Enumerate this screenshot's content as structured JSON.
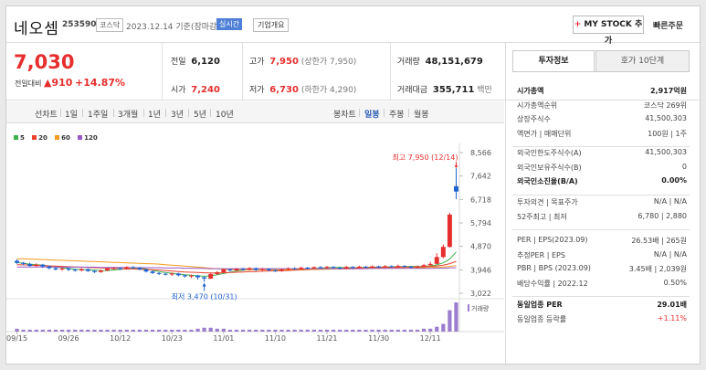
{
  "header": {
    "company": "네오셈",
    "code": "253590",
    "market": "코스닥",
    "date_note": "2023.12.14 기준(장마감)",
    "realtime_label": "실시간",
    "corp_info_label": "기업개요",
    "my_stock_label": "MY STOCK 추가",
    "quick_order_label": "빠른주문"
  },
  "price": {
    "current": "7,030",
    "change_label": "전일대비",
    "change_arrow": "▲",
    "change_amount": "910",
    "change_pct": "+14.87%"
  },
  "quote": {
    "prev_close_label": "전일",
    "prev_close": "6,120",
    "open_label": "시가",
    "open": "7,240",
    "high_label": "고가",
    "high": "7,950",
    "upper_limit": "(상한가 7,950)",
    "low_label": "저가",
    "low": "6,730",
    "lower_limit": "(하한가 4,290)",
    "volume_label": "거래량",
    "volume": "48,151,679",
    "value_label": "거래대금",
    "value": "355,711",
    "value_unit": "백만"
  },
  "toolbar": {
    "line_label": "선차트",
    "line_periods": [
      "1일",
      "1주일",
      "3개월",
      "1년",
      "3년",
      "5년",
      "10년"
    ],
    "candle_label": "봉차트",
    "candle_periods": [
      "일봉",
      "주봉",
      "월봉"
    ],
    "active_candle": "일봉"
  },
  "legend": [
    {
      "label": "5",
      "color": "#3bb34a"
    },
    {
      "label": "20",
      "color": "#e8422f"
    },
    {
      "label": "60",
      "color": "#f39a1e"
    },
    {
      "label": "120",
      "color": "#9b59c4"
    }
  ],
  "chart_data": {
    "type": "line",
    "x_ticks": [
      "09/15",
      "09/26",
      "10/12",
      "10/23",
      "11/01",
      "11/10",
      "11/21",
      "11/30",
      "12/11"
    ],
    "y_ticks": [
      "8,566",
      "7,642",
      "6,718",
      "5,794",
      "4,870",
      "3,946",
      "3,022"
    ],
    "ylim": [
      3022,
      8566
    ],
    "annotations": {
      "high": "최고 7,950 (12/14)",
      "low": "최저 3,470 (10/31)"
    },
    "volume_label": "거래량",
    "candles": [
      {
        "o": 4300,
        "c": 4220,
        "h": 4360,
        "l": 4180
      },
      {
        "o": 4220,
        "c": 4180,
        "h": 4260,
        "l": 4120
      },
      {
        "o": 4170,
        "c": 4100,
        "h": 4230,
        "l": 4060
      },
      {
        "o": 4100,
        "c": 4150,
        "h": 4200,
        "l": 4050
      },
      {
        "o": 4150,
        "c": 4080,
        "h": 4180,
        "l": 4020
      },
      {
        "o": 4080,
        "c": 4010,
        "h": 4120,
        "l": 3960
      },
      {
        "o": 4010,
        "c": 3960,
        "h": 4060,
        "l": 3920
      },
      {
        "o": 3960,
        "c": 4000,
        "h": 4050,
        "l": 3910
      },
      {
        "o": 4000,
        "c": 3950,
        "h": 4030,
        "l": 3900
      },
      {
        "o": 3950,
        "c": 3920,
        "h": 3990,
        "l": 3870
      },
      {
        "o": 3920,
        "c": 3970,
        "h": 4020,
        "l": 3880
      },
      {
        "o": 3970,
        "c": 3900,
        "h": 4000,
        "l": 3860
      },
      {
        "o": 3900,
        "c": 3860,
        "h": 3940,
        "l": 3820
      },
      {
        "o": 3860,
        "c": 3920,
        "h": 3960,
        "l": 3830
      },
      {
        "o": 3920,
        "c": 3990,
        "h": 4030,
        "l": 3890
      },
      {
        "o": 3990,
        "c": 4010,
        "h": 4060,
        "l": 3950
      },
      {
        "o": 4010,
        "c": 3980,
        "h": 4050,
        "l": 3940
      },
      {
        "o": 3980,
        "c": 4050,
        "h": 4090,
        "l": 3950
      },
      {
        "o": 4050,
        "c": 4020,
        "h": 4100,
        "l": 3990
      },
      {
        "o": 4020,
        "c": 3960,
        "h": 4060,
        "l": 3930
      },
      {
        "o": 3960,
        "c": 3880,
        "h": 3990,
        "l": 3840
      },
      {
        "o": 3880,
        "c": 3820,
        "h": 3920,
        "l": 3780
      },
      {
        "o": 3820,
        "c": 3790,
        "h": 3850,
        "l": 3740
      },
      {
        "o": 3790,
        "c": 3760,
        "h": 3820,
        "l": 3720
      },
      {
        "o": 3760,
        "c": 3800,
        "h": 3840,
        "l": 3700
      },
      {
        "o": 3800,
        "c": 3730,
        "h": 3830,
        "l": 3690
      },
      {
        "o": 3730,
        "c": 3690,
        "h": 3760,
        "l": 3640
      },
      {
        "o": 3690,
        "c": 3720,
        "h": 3760,
        "l": 3620
      },
      {
        "o": 3720,
        "c": 3650,
        "h": 3750,
        "l": 3560
      },
      {
        "o": 3650,
        "c": 3600,
        "h": 3680,
        "l": 3470
      },
      {
        "o": 3600,
        "c": 3780,
        "h": 3820,
        "l": 3580
      },
      {
        "o": 3780,
        "c": 3850,
        "h": 3900,
        "l": 3740
      },
      {
        "o": 3850,
        "c": 3960,
        "h": 4000,
        "l": 3820
      },
      {
        "o": 3960,
        "c": 3920,
        "h": 4010,
        "l": 3880
      },
      {
        "o": 3920,
        "c": 3980,
        "h": 4020,
        "l": 3890
      },
      {
        "o": 3980,
        "c": 3950,
        "h": 4020,
        "l": 3910
      },
      {
        "o": 3950,
        "c": 4010,
        "h": 4050,
        "l": 3920
      },
      {
        "o": 4010,
        "c": 3940,
        "h": 4040,
        "l": 3900
      },
      {
        "o": 3940,
        "c": 3980,
        "h": 4020,
        "l": 3900
      },
      {
        "o": 3980,
        "c": 3930,
        "h": 4010,
        "l": 3890
      },
      {
        "o": 3930,
        "c": 3900,
        "h": 3960,
        "l": 3860
      },
      {
        "o": 3900,
        "c": 3960,
        "h": 4000,
        "l": 3870
      },
      {
        "o": 3960,
        "c": 4000,
        "h": 4040,
        "l": 3930
      },
      {
        "o": 4000,
        "c": 3980,
        "h": 4040,
        "l": 3950
      },
      {
        "o": 3980,
        "c": 4030,
        "h": 4070,
        "l": 3950
      },
      {
        "o": 4030,
        "c": 4000,
        "h": 4060,
        "l": 3960
      },
      {
        "o": 4000,
        "c": 4050,
        "h": 4080,
        "l": 3970
      },
      {
        "o": 4050,
        "c": 4020,
        "h": 4090,
        "l": 3990
      },
      {
        "o": 4020,
        "c": 4060,
        "h": 4100,
        "l": 3990
      },
      {
        "o": 4060,
        "c": 4030,
        "h": 4090,
        "l": 4000
      },
      {
        "o": 4030,
        "c": 4000,
        "h": 4070,
        "l": 3960
      },
      {
        "o": 4000,
        "c": 4060,
        "h": 4100,
        "l": 3970
      },
      {
        "o": 4060,
        "c": 4020,
        "h": 4090,
        "l": 3990
      },
      {
        "o": 4020,
        "c": 4070,
        "h": 4110,
        "l": 4000
      },
      {
        "o": 4070,
        "c": 4040,
        "h": 4100,
        "l": 4010
      },
      {
        "o": 4040,
        "c": 4080,
        "h": 4120,
        "l": 4010
      },
      {
        "o": 4080,
        "c": 4050,
        "h": 4110,
        "l": 4020
      },
      {
        "o": 4050,
        "c": 4090,
        "h": 4130,
        "l": 4020
      },
      {
        "o": 4090,
        "c": 4060,
        "h": 4120,
        "l": 4030
      },
      {
        "o": 4060,
        "c": 4100,
        "h": 4150,
        "l": 4030
      },
      {
        "o": 4100,
        "c": 4070,
        "h": 4130,
        "l": 4040
      },
      {
        "o": 4070,
        "c": 4040,
        "h": 4100,
        "l": 4010
      },
      {
        "o": 4040,
        "c": 4080,
        "h": 4120,
        "l": 4000
      },
      {
        "o": 4080,
        "c": 4130,
        "h": 4180,
        "l": 4050
      },
      {
        "o": 4130,
        "c": 4180,
        "h": 4260,
        "l": 4100
      },
      {
        "o": 4180,
        "c": 4450,
        "h": 4600,
        "l": 4170
      },
      {
        "o": 4450,
        "c": 4850,
        "h": 4950,
        "l": 4400
      },
      {
        "o": 4850,
        "c": 6120,
        "h": 6200,
        "l": 4820
      },
      {
        "o": 7240,
        "c": 7030,
        "h": 7950,
        "l": 6730
      }
    ],
    "volumes": [
      3,
      2,
      2,
      2,
      2,
      2,
      2,
      2,
      2,
      2,
      2,
      2,
      2,
      2,
      2,
      2,
      2,
      2,
      2,
      2,
      2,
      2,
      2,
      2,
      2,
      2,
      2,
      2,
      3,
      4,
      4,
      3,
      3,
      2,
      2,
      2,
      2,
      2,
      2,
      2,
      2,
      2,
      2,
      2,
      2,
      2,
      2,
      2,
      2,
      2,
      2,
      2,
      2,
      2,
      2,
      2,
      2,
      2,
      2,
      2,
      2,
      2,
      2,
      3,
      3,
      5,
      8,
      22,
      30
    ],
    "ma": {
      "5": [
        4240,
        4200,
        4170,
        4150,
        4130,
        4100,
        4060,
        4030,
        4000,
        3970,
        3960,
        3950,
        3930,
        3910,
        3920,
        3940,
        3960,
        3990,
        4010,
        4010,
        3980,
        3930,
        3880,
        3840,
        3810,
        3780,
        3750,
        3730,
        3710,
        3690,
        3710,
        3750,
        3800,
        3850,
        3900,
        3930,
        3950,
        3960,
        3960,
        3960,
        3950,
        3940,
        3940,
        3950,
        3960,
        3980,
        4000,
        4010,
        4030,
        4040,
        4040,
        4030,
        4030,
        4030,
        4040,
        4050,
        4050,
        4060,
        4060,
        4070,
        4070,
        4080,
        4080,
        4080,
        4100,
        4140,
        4220,
        4370,
        4650
      ],
      "20": [
        4150,
        4140,
        4130,
        4120,
        4110,
        4100,
        4090,
        4080,
        4070,
        4060,
        4050,
        4040,
        4030,
        4020,
        4010,
        4000,
        3990,
        3980,
        3980,
        3970,
        3960,
        3950,
        3940,
        3920,
        3900,
        3880,
        3860,
        3850,
        3840,
        3830,
        3820,
        3820,
        3830,
        3840,
        3850,
        3860,
        3870,
        3880,
        3890,
        3900,
        3900,
        3910,
        3920,
        3930,
        3940,
        3950,
        3960,
        3970,
        3980,
        3990,
        4000,
        4000,
        4010,
        4020,
        4020,
        4030,
        4030,
        4040,
        4040,
        4050,
        4050,
        4060,
        4060,
        4070,
        4080,
        4100,
        4130,
        4190,
        4280
      ],
      "60": [
        4380,
        4380,
        4370,
        4360,
        4350,
        4340,
        4330,
        4320,
        4310,
        4300,
        4290,
        4280,
        4270,
        4260,
        4250,
        4240,
        4230,
        4220,
        4210,
        4200,
        4190,
        4180,
        4170,
        4150,
        4130,
        4110,
        4090,
        4070,
        4050,
        4030,
        4010,
        3990,
        3970,
        3960,
        3950,
        3950,
        3950,
        3950,
        3950,
        3950,
        3950,
        3950,
        3950,
        3960,
        3960,
        3960,
        3970,
        3970,
        3970,
        3980,
        3980,
        3980,
        3990,
        3990,
        4000,
        4000,
        4000,
        4010,
        4010,
        4010,
        4020,
        4020,
        4030,
        4030,
        4040,
        4050,
        4060,
        4080,
        4110
      ],
      "120": [
        4060,
        4060,
        4060,
        4060,
        4060,
        4060,
        4060,
        4050,
        4050,
        4050,
        4050,
        4050,
        4050,
        4040,
        4040,
        4040,
        4040,
        4040,
        4030,
        4030,
        4030,
        4030,
        4030,
        4020,
        4020,
        4020,
        4010,
        4010,
        4000,
        4000,
        3990,
        3990,
        3990,
        3990,
        3990,
        3990,
        3990,
        3990,
        3990,
        3990,
        3990,
        3990,
        3990,
        3990,
        3990,
        3990,
        3990,
        3990,
        3990,
        3990,
        3990,
        3990,
        3990,
        3990,
        3990,
        4000,
        4000,
        4000,
        4000,
        4000,
        4000,
        4000,
        4000,
        4000,
        4000,
        4010,
        4010,
        4020,
        4030
      ]
    }
  },
  "panel": {
    "tab_active": "투자정보",
    "tab_other": "호가 10단계",
    "rows1": [
      {
        "label": "시가총액",
        "value": "2,917억원",
        "bold": true
      },
      {
        "label": "시가총액순위",
        "value": "코스닥 269위"
      },
      {
        "label": "상장주식수",
        "value": "41,500,303"
      },
      {
        "label": "액면가 | 매매단위",
        "value": "100원 | 1주"
      }
    ],
    "rows2": [
      {
        "label": "외국인한도주식수(A)",
        "value": "41,500,303"
      },
      {
        "label": "외국인보유주식수(B)",
        "value": "0"
      },
      {
        "label": "외국인소진율(B/A)",
        "value": "0.00%",
        "bold": true
      }
    ],
    "rows3": [
      {
        "label": "투자의견 | 목표주가",
        "value": "N/A | N/A"
      },
      {
        "label": "52주최고 | 최저",
        "value": "6,780 | 2,880"
      }
    ],
    "rows4": [
      {
        "label": "PER | EPS(2023.09)",
        "value": "26.53배 | 265원"
      },
      {
        "label": "추정PER | EPS",
        "value": "N/A | N/A"
      },
      {
        "label": "PBR | BPS (2023.09)",
        "value": "3.45배 | 2,039원"
      },
      {
        "label": "배당수익률 | 2022.12",
        "value": "0.50%"
      }
    ],
    "rows5": [
      {
        "label": "동일업종 PER",
        "value": "29.01배",
        "bold": true
      },
      {
        "label": "동일업종 등락률",
        "value": "+1.11%",
        "red": true
      }
    ]
  }
}
